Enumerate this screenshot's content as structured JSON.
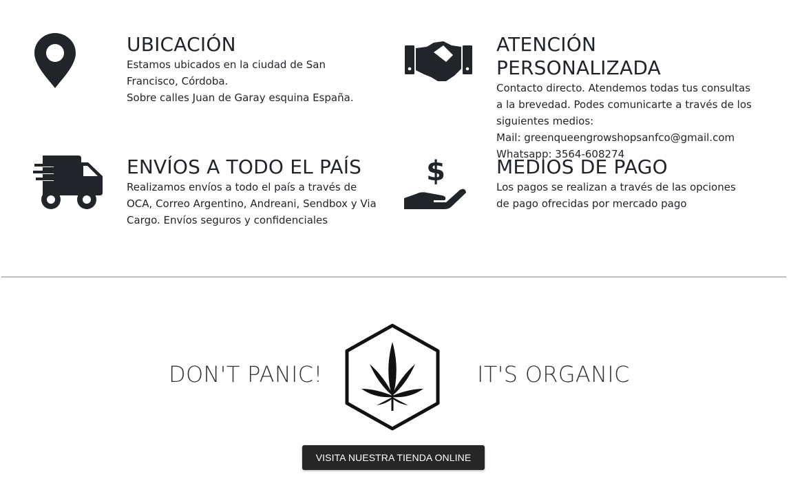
{
  "features": {
    "ubicacion": {
      "icon": "map-pin-icon",
      "title": "UBICACIÓN",
      "lines": [
        "Estamos ubicados en la ciudad de San Francisco, Córdoba.",
        "Sobre calles Juan de Garay esquina España."
      ]
    },
    "atencion": {
      "icon": "handshake-icon",
      "title": "ATENCIÓN PERSONALIZADA",
      "lines": [
        "Contacto directo. Atendemos todas tus consultas a la brevedad. Podes comunicarte a través de los siguientes medios:",
        "Mail: greenqueengrowshopsanfco@gmail.com",
        "Whatsapp: 3564-608274"
      ]
    },
    "envios": {
      "icon": "delivery-truck-icon",
      "title": "ENVÍOS A TODO EL PAÍS",
      "lines": [
        "Realizamos envíos a todo el país a través de OCA, Correo Argentino, Andreani, Sendbox y Via Cargo. Envíos seguros y confidenciales"
      ]
    },
    "pago": {
      "icon": "hand-holding-dollar-icon",
      "title": "MEDIOS DE PAGO",
      "lines": [
        "Los pagos se realizan a través de las opciones de pago ofrecidas por mercado pago"
      ]
    }
  },
  "slogan": {
    "left": "DON'T PANIC!",
    "right": "IT'S ORGANIC",
    "logo_icon": "cannabis-leaf-hexagon-icon"
  },
  "cta": {
    "label": "VISITA NUESTRA TIENDA ONLINE"
  },
  "colors": {
    "text": "#212529",
    "button_bg": "#262626",
    "button_text": "#ffffff",
    "divider": "#8a8a8a"
  }
}
